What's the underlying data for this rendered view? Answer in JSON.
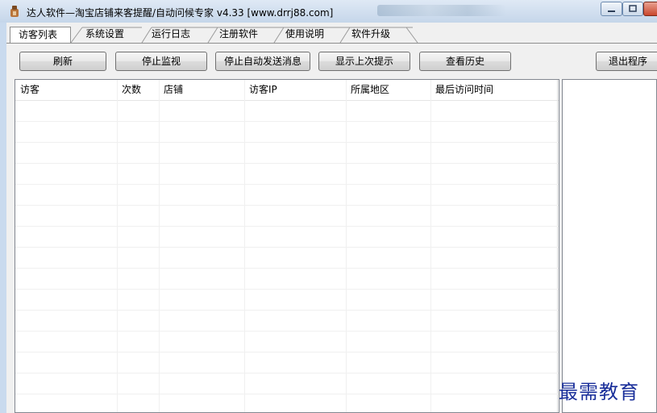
{
  "window": {
    "title": "达人软件—淘宝店铺来客提醒/自动问候专家 v4.33  [www.drrj88.com]"
  },
  "tabs": [
    {
      "label": "访客列表",
      "active": true
    },
    {
      "label": "系统设置",
      "active": false
    },
    {
      "label": "运行日志",
      "active": false
    },
    {
      "label": "注册软件",
      "active": false
    },
    {
      "label": "使用说明",
      "active": false
    },
    {
      "label": "软件升级",
      "active": false
    }
  ],
  "toolbar": {
    "refresh": "刷新",
    "stop_monitor": "停止监视",
    "stop_auto_send": "停止自动发送消息",
    "show_last_tip": "显示上次提示",
    "view_history": "查看历史",
    "exit": "退出程序"
  },
  "table": {
    "columns": [
      "访客",
      "次数",
      "店铺",
      "访客IP",
      "所属地区",
      "最后访问时间"
    ],
    "rows": []
  },
  "watermark": "最需教育",
  "colors": {
    "window_frame": "#c9daee",
    "watermark": "#1a2f9a",
    "close_button": "#c9462c"
  }
}
